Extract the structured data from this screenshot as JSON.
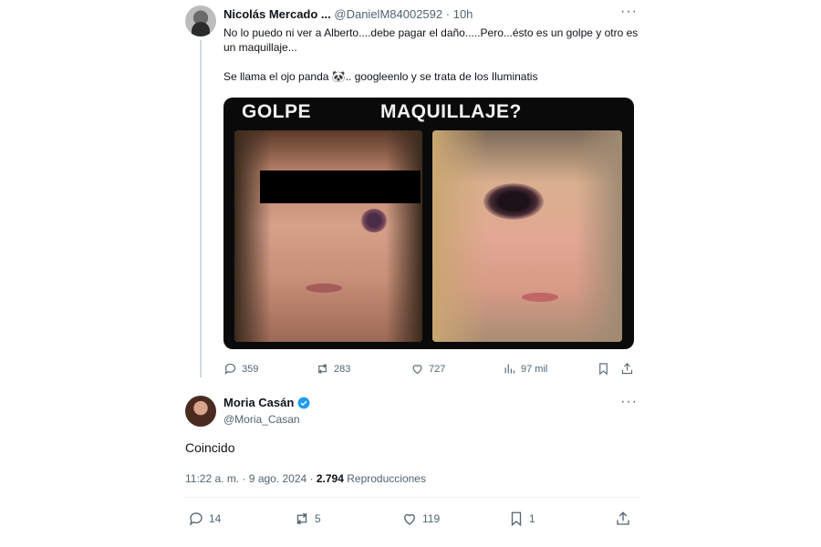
{
  "tweet1": {
    "author_name": "Nicolás Mercado ...",
    "handle": "@DanielM84002592",
    "time": "10h",
    "text_line1": "No lo puedo ni ver a Alberto....debe pagar el daño.....Pero...ésto es un golpe y otro es un maquillaje...",
    "text_line2": "Se llama el ojo panda 🐼.. googleenlo y se trata de los Iluminatis",
    "media": {
      "label_left": "GOLPE",
      "label_right": "MAQUILLAJE?"
    },
    "actions": {
      "replies": "359",
      "retweets": "283",
      "likes": "727",
      "views": "97 mil"
    }
  },
  "tweet2": {
    "author_name": "Moria Casán",
    "handle": "@Moria_Casan",
    "text": "Coincido",
    "timestamp": "11:22 a. m. · 9 ago. 2024 · ",
    "views_count": "2.794",
    "views_label": " Reproducciones",
    "actions": {
      "replies": "14",
      "retweets": "5",
      "likes": "119",
      "bookmarks": "1"
    }
  },
  "ui": {
    "more_glyph": "···",
    "accent": "#1d9bf0",
    "muted": "#536471"
  }
}
